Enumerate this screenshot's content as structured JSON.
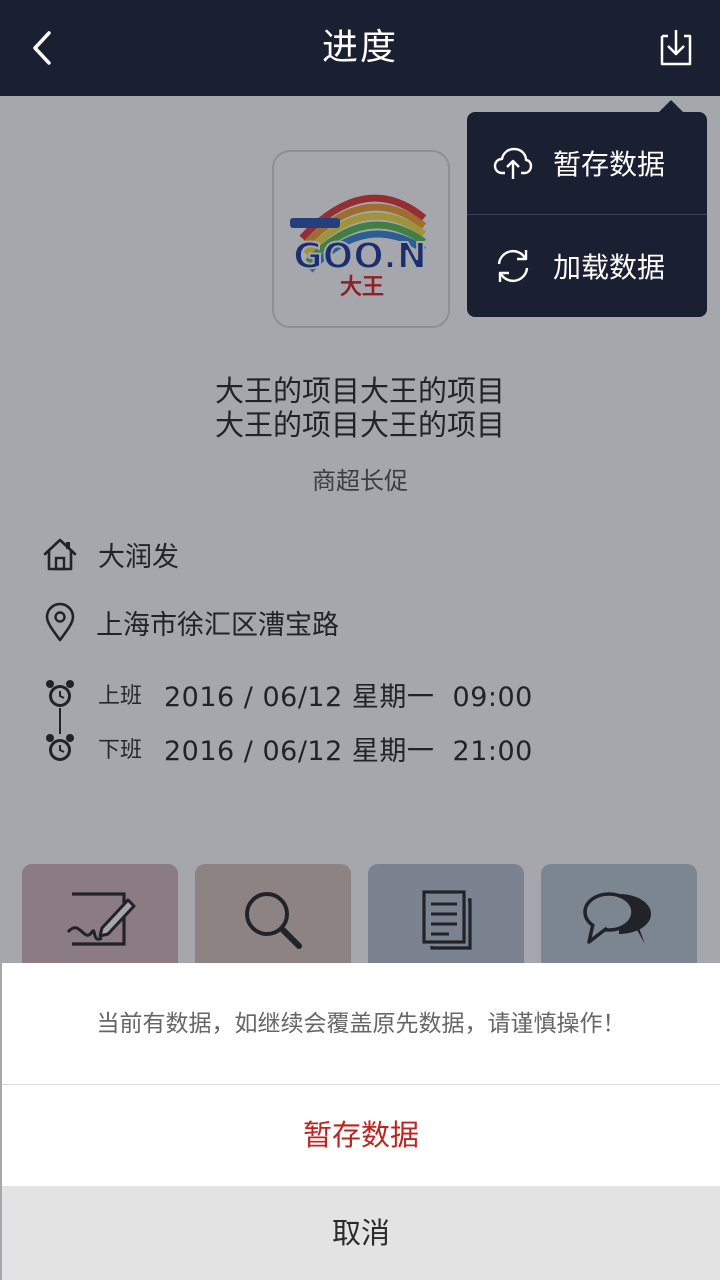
{
  "header": {
    "title": "进度",
    "back_icon": "chevron-left-icon",
    "download_icon": "download-icon",
    "background_color": "#1a2032"
  },
  "project": {
    "logo_brand": "GOO.N",
    "logo_subtext": "大王",
    "title_line1": "大王的项目大王的项目",
    "title_line2": "大王的项目大王的项目",
    "subtitle": "商超长促"
  },
  "info": {
    "store": "大润发",
    "address": "上海市徐汇区漕宝路"
  },
  "schedule": {
    "start_label": "上班",
    "start_value": "2016 / 06/12 星期一  09:00",
    "end_label": "下班",
    "end_value": "2016 / 06/12 星期一  21:00"
  },
  "tiles": [
    {
      "icon": "edit-icon",
      "color": "#d4b9bd"
    },
    {
      "icon": "search-icon",
      "color": "#d9c6bd"
    },
    {
      "icon": "document-icon",
      "color": "#b9c6d0"
    },
    {
      "icon": "chat-icon",
      "color": "#bccad3"
    }
  ],
  "dropdown": {
    "items": [
      {
        "label": "暂存数据",
        "icon": "cloud-upload-icon"
      },
      {
        "label": "加载数据",
        "icon": "refresh-icon"
      }
    ]
  },
  "sheet": {
    "message": "当前有数据，如继续会覆盖原先数据，请谨慎操作！",
    "confirm_label": "暂存数据",
    "cancel_label": "取消",
    "confirm_color": "#c0221e"
  }
}
